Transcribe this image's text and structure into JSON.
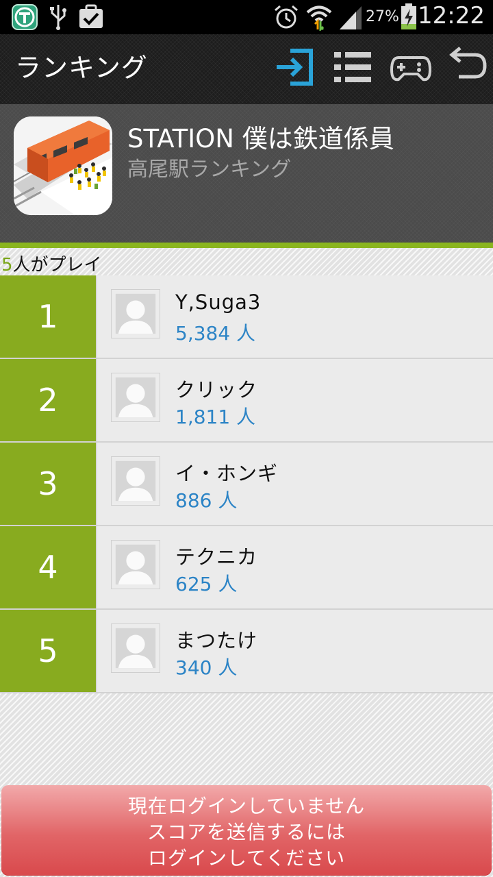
{
  "status_bar": {
    "battery_percent": "27%",
    "time": "12:22",
    "icons": [
      "t-app-icon",
      "usb-icon",
      "task-check-icon",
      "alarm-icon",
      "wifi-icon",
      "signal-icon",
      "battery-charging-icon"
    ]
  },
  "action_bar": {
    "title": "ランキング",
    "buttons": [
      "login-icon",
      "list-icon",
      "gamepad-icon",
      "back-icon"
    ],
    "accent": "#2aa3d8"
  },
  "app": {
    "name": "STATION 僕は鉄道係員",
    "subtitle": "高尾駅ランキング"
  },
  "players": {
    "count": "5",
    "suffix": "人がプレイ"
  },
  "ranking": [
    {
      "rank": "1",
      "name": "Y,Suga3",
      "score": "5,384 人"
    },
    {
      "rank": "2",
      "name": "クリック",
      "score": "1,811 人"
    },
    {
      "rank": "3",
      "name": "イ・ホンギ",
      "score": "886 人"
    },
    {
      "rank": "4",
      "name": "テクニカ",
      "score": "625 人"
    },
    {
      "rank": "5",
      "name": "まつたけ",
      "score": "340 人"
    }
  ],
  "login_banner": {
    "line1": "現在ログインしていません",
    "line2": "スコアを送信するには",
    "line3": "ログインしてください"
  },
  "colors": {
    "rank_green": "#88ab1f",
    "score_blue": "#2c84c6",
    "banner_red": "#e16567"
  }
}
